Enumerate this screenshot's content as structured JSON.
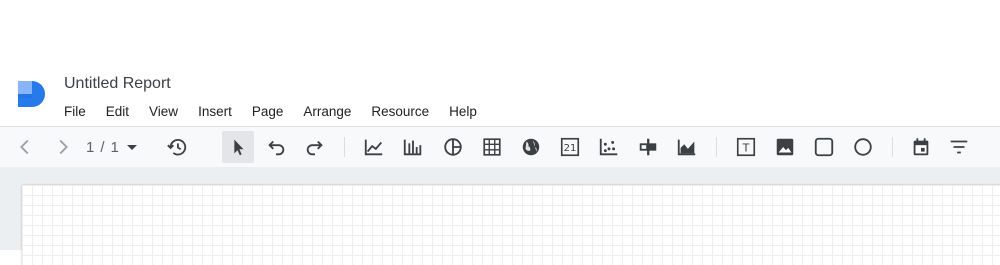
{
  "app": {
    "title": "Untitled Report"
  },
  "menu": [
    "File",
    "Edit",
    "View",
    "Insert",
    "Page",
    "Arrange",
    "Resource",
    "Help"
  ],
  "pager": {
    "current": "1",
    "separator": "/",
    "total": "1"
  },
  "icons": {
    "back": "chevron-left-icon",
    "forward": "chevron-right-icon",
    "history": "history-icon",
    "select": "cursor-icon",
    "undo": "undo-icon",
    "redo": "redo-icon",
    "time_series": "time-series-chart-icon",
    "bar": "bar-chart-icon",
    "pie": "pie-chart-icon",
    "table": "table-icon",
    "geo": "globe-icon",
    "scorecard": "scorecard-icon",
    "scatter": "scatter-chart-icon",
    "bullet": "bullet-chart-icon",
    "area": "area-chart-icon",
    "text": "text-box-icon",
    "image": "image-icon",
    "rectangle": "rectangle-icon",
    "circle": "circle-icon",
    "date_range": "calendar-icon",
    "filter": "filter-icon"
  },
  "scorecard_text": "21",
  "text_tool_glyph": "T",
  "colors": {
    "accent": "#4285f4",
    "toolbar_bg": "#f8f9fa",
    "canvas_bg": "#eceff1"
  }
}
